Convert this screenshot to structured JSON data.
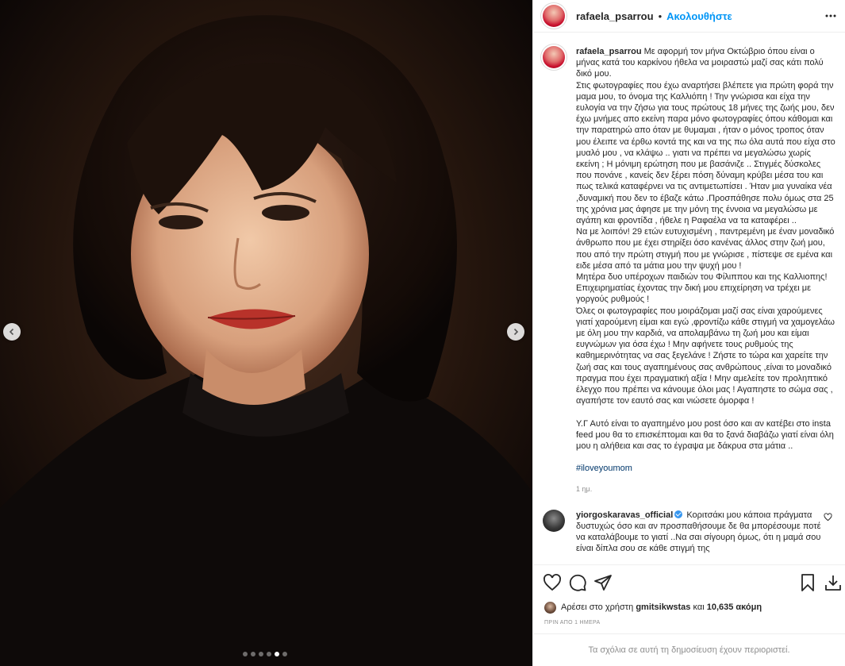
{
  "post": {
    "username": "rafaela_psarrou",
    "bullet": "•",
    "follow_label": "Ακολουθήστε",
    "carousel": {
      "total_slides": 6,
      "active_slide": 5
    }
  },
  "caption": {
    "username": "rafaela_psarrou",
    "text": "Με αφορμή τον μήνα Οκτώβριο όπου είναι ο μήνας κατά του καρκίνου ήθελα να μοιραστώ μαζί σας κάτι πολύ δικό μου.\nΣτις φωτογραφίες που έχω αναρτήσει βλέπετε για πρώτη φορά την μαμα μου, το όνομα της Καλλιόπη ! Την γνώρισα και είχα την ευλογία να την ζήσω για τους πρώτους 18 μήνες της ζωής μου, δεν έχω μνήμες απο εκείνη παρα μόνο φωτογραφίες όπου κάθομαι και την παρατηρώ απο όταν με θυμαμαι , ήταν ο μόνος τροπος όταν μου έλειπε να έρθω κοντά της και να της πω όλα αυτά που είχα στο μυαλό μου , να κλάψω .. γιατι να πρέπει να μεγαλώσω χωρίς εκείνη ; Η μόνιμη ερώτηση που με βασάνιζε .. Στιγμές δύσκολες που πονάνε , κανείς δεν ξέρει πόση δύναμη κρύβει μέσα του και πως τελικά καταφέρνει να τις αντιμετωπίσει . Ήταν μια γυναίκα νέα ,δυναμική που δεν το έβαζε κάτω .Προσπάθησε πολυ όμως στα 25 της χρόνια μας άφησε με την μόνη της έννοια να μεγαλώσω με αγάπη και φροντίδα , ήθελε η Ραφαέλα να τα καταφέρει ..\nΝα με λοιπόν! 29 ετών ευτυχισμένη , παντρεμένη με έναν μοναδικό άνθρωπο που με έχει στηρίξει όσο κανένας άλλος στην ζωή μου, που από την πρώτη στιγμή που με γνώρισε , πίστεψε σε εμένα και ειδε μέσα από τα μάτια μου την ψυχή μου !\nΜητέρα δυο υπέροχων παιδιών του Φίλιππου και της Καλλιοπης!\nΕπιχειρηματίας έχοντας την δική μου επιχείρηση να τρέχει με γοργούς ρυθμούς !\nΌλες οι φωτογραφίες που μοιράζομαι μαζί σας είναι χαρούμενες γιατί χαρούμενη είμαι και εγώ ,φροντίζω κάθε στιγμή να χαμογελάω με όλη μου την καρδιά, να απολαμβάνω τη ζωή μου και είμαι ευγνώμων για όσα έχω ! Μην αφήνετε τους ρυθμούς της καθημερινότητας να σας ξεγελάνε ! Ζήστε το τώρα και χαρείτε την ζωή σας και τους αγαπημένους σας ανθρώπους ,είναι το μοναδικό πραγμα που έχει πραγματική αξία ! Μην αμελείτε τον προληπτικό έλεγχο που πρέπει να κάνουμε όλοι μας ! Αγαπηστε το σώμα σας , αγαπήστε τον εαυτό σας και νιώσετε όμορφα !",
    "ps": "Υ.Γ Αυτό είναι το αγαπημένο μου post όσο και αν κατέβει στο insta feed μου θα το επισκέπτομαι και θα το ξανά διαβάζω γιατί είναι όλη μου η αλήθεια και σας το έγραψα με δάκρυα στα μάτια ..",
    "hashtag": "#iloveyoumom",
    "time": "1 ημ."
  },
  "comment": {
    "username": "yiorgoskaravas_official",
    "text": "Κοριτσάκι μου κάποια πράγματα δυστυχώς όσο και αν προσπαθήσουμε δε θα μπορέσουμε ποτέ να καταλάβουμε το γιατί ..Να σαι σίγουρη όμως, ότι η μαμά σου είναι δίπλα σου σε κάθε στιγμή της"
  },
  "likes": {
    "prefix": "Αρέσει στο χρήστη",
    "user": "gmitsikwstas",
    "middle": "και",
    "count": "10,635 ακόμη"
  },
  "post_time": "ΠΡΙΝ ΑΠΟ 1 ΗΜΕΡΑ",
  "restricted_text": "Τα σχόλια σε αυτή τη δημοσίευση έχουν περιοριστεί.",
  "icons": {
    "header_more": "more-horizontal-icon",
    "like": "heart-icon",
    "comment": "comment-icon",
    "share": "paper-plane-icon",
    "save": "bookmark-icon",
    "download": "download-icon"
  },
  "colors": {
    "link": "#0095f6",
    "hashtag": "#00376b",
    "muted": "#8e8e8e",
    "text": "#262626"
  }
}
